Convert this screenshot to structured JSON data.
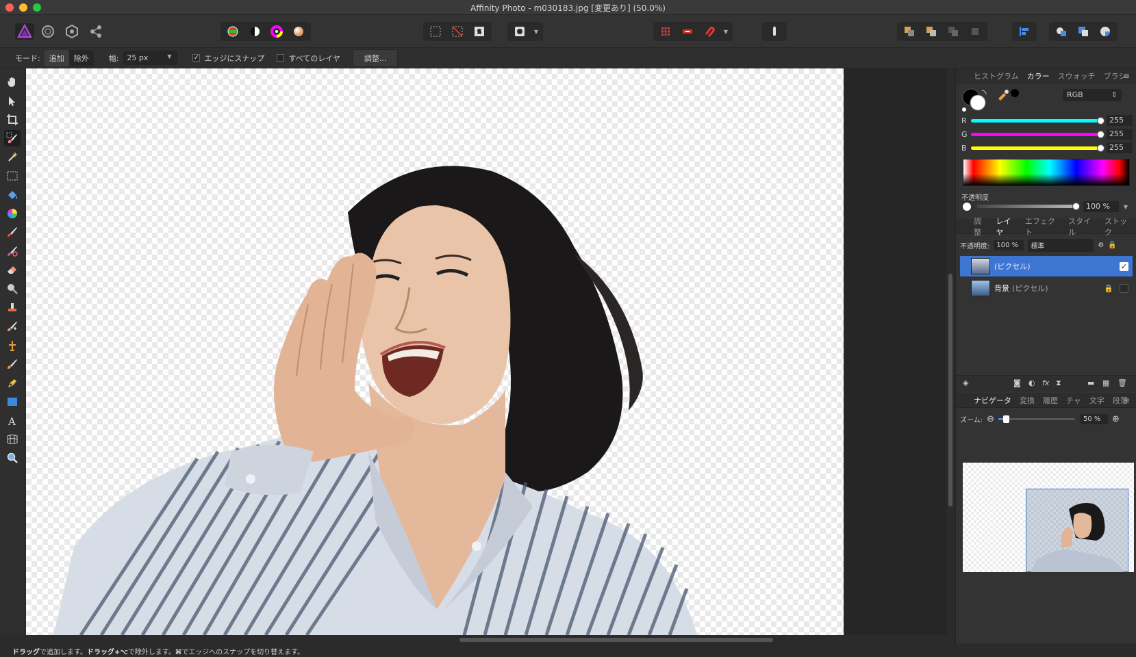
{
  "window": {
    "title": "Affinity Photo - m030183.jpg [変更あり] (50.0%)"
  },
  "context_toolbar": {
    "mode_label": "モード:",
    "mode_add": "追加",
    "mode_remove": "除外",
    "width_label": "幅:",
    "width_value": "25 px",
    "snap_edges": "エッジにスナップ",
    "snap_edges_checked": "✓",
    "all_layers": "すべてのレイヤ",
    "refine_button": "調整..."
  },
  "colors": {
    "accent": "#3d76d2",
    "panel": "#333333",
    "canvas_bg": "#262626"
  },
  "color_panel": {
    "tabs": [
      "ヒストグラム",
      "カラー",
      "スウォッチ",
      "ブラシ"
    ],
    "active_tab": "カラー",
    "model": "RGB",
    "channels": [
      {
        "label": "R",
        "value": "255",
        "fraction": 1.0
      },
      {
        "label": "G",
        "value": "255",
        "fraction": 1.0
      },
      {
        "label": "B",
        "value": "255",
        "fraction": 1.0
      }
    ],
    "opacity_label": "不透明度",
    "opacity_value": "100 %"
  },
  "layers_panel": {
    "tabs": [
      "調整",
      "レイヤ",
      "エフェクト",
      "スタイル",
      "ストック"
    ],
    "active_tab": "レイヤ",
    "opacity_label": "不透明度:",
    "opacity_value": "100 %",
    "blend_mode": "標準",
    "layers": [
      {
        "name": "",
        "type": "(ピクセル)",
        "selected": true
      },
      {
        "name": "背景",
        "type": "(ピクセル)",
        "selected": false
      }
    ]
  },
  "navigator_panel": {
    "tabs": [
      "ナビゲータ",
      "変換",
      "履歴",
      "チャ",
      "文字",
      "段落"
    ],
    "active_tab": "ナビゲータ",
    "zoom_label": "ズーム:",
    "zoom_value": "50 %",
    "zoom_fraction": 0.1
  },
  "status": {
    "part1_bold": "ドラッグ",
    "part2": "で追加します。",
    "part3_bold": "ドラッグ+⌥",
    "part4": "で除外します。",
    "part5_bold": "⌘",
    "part6": "でエッジへのスナップを切り替えます。"
  },
  "icons": {
    "personas": [
      "photo-persona-icon",
      "liquify-persona-icon",
      "develop-persona-icon",
      "export-persona-icon"
    ],
    "tools": [
      "hand-icon",
      "move-icon",
      "crop-icon",
      "selection-brush-icon",
      "magic-wand-icon",
      "marquee-icon",
      "flood-fill-icon",
      "color-picker-icon",
      "paint-brush-icon",
      "color-replace-icon",
      "eraser-icon",
      "dodge-icon",
      "clone-icon",
      "healing-icon",
      "perspective-icon",
      "smudge-icon",
      "pen-icon",
      "shape-icon",
      "text-icon",
      "mesh-warp-icon",
      "zoom-icon"
    ]
  }
}
